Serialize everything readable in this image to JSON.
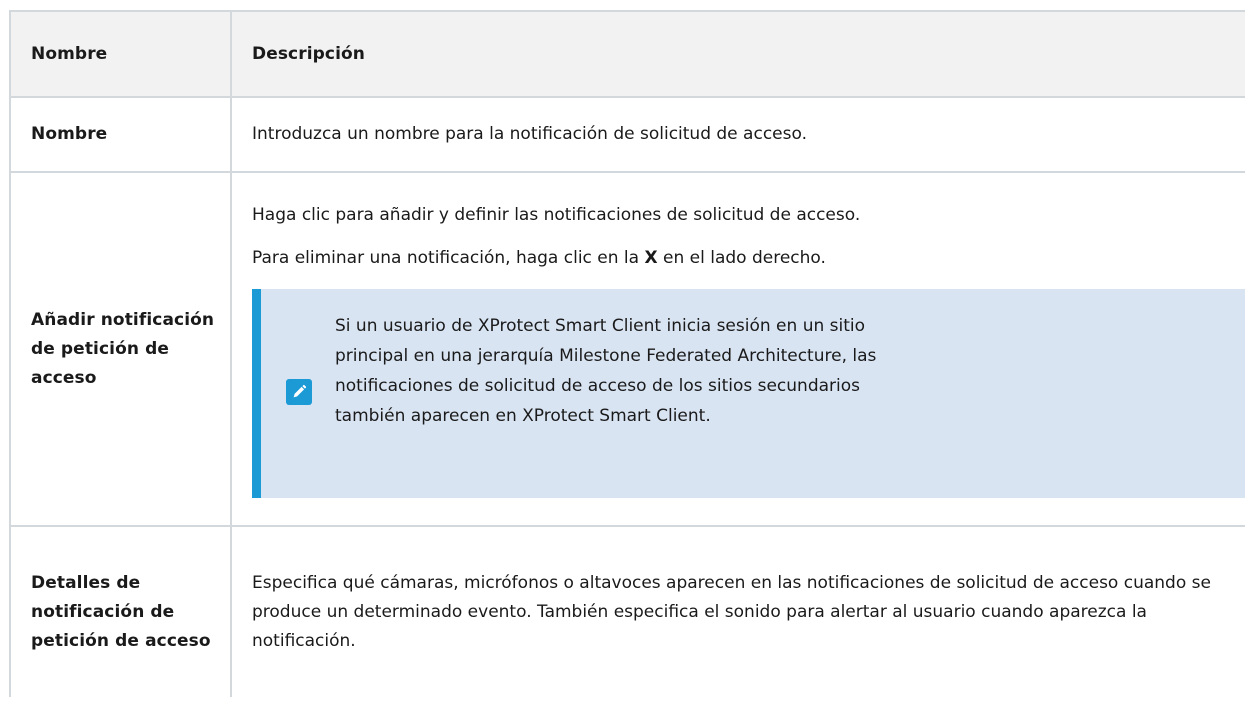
{
  "table": {
    "header": {
      "col_name": "Nombre",
      "col_description": "Descripción"
    },
    "rows": [
      {
        "name": "Nombre",
        "description": "Introduzca un nombre para la notificación de solicitud de acceso."
      },
      {
        "name": "Añadir notificación de petición de acceso",
        "paragraph1": "Haga clic para añadir y definir las notificaciones de solicitud de acceso.",
        "paragraph2_before": "Para eliminar una notificación, haga clic en la ",
        "paragraph2_bold": "X",
        "paragraph2_after": " en el lado derecho.",
        "note": {
          "icon": "pencil-note-icon",
          "text": "Si un usuario de XProtect Smart Client inicia sesión en un sitio principal en una jerarquía Milestone Federated Architecture, las notificaciones de solicitud de acceso de los sitios secundarios también aparecen en XProtect Smart Client."
        }
      },
      {
        "name": "Detalles de notificación de petición de acceso",
        "description": "Especifica qué cámaras, micrófonos o altavoces aparecen en las notificaciones de solicitud de acceso cuando se produce un determinado evento. También especifica el sonido para alertar al usuario cuando aparezca la notificación."
      }
    ]
  },
  "colors": {
    "border": "#d3d8dc",
    "header_bg": "#f2f2f2",
    "note_bg": "#d9e4f3",
    "note_accent": "#1c9ad6"
  }
}
